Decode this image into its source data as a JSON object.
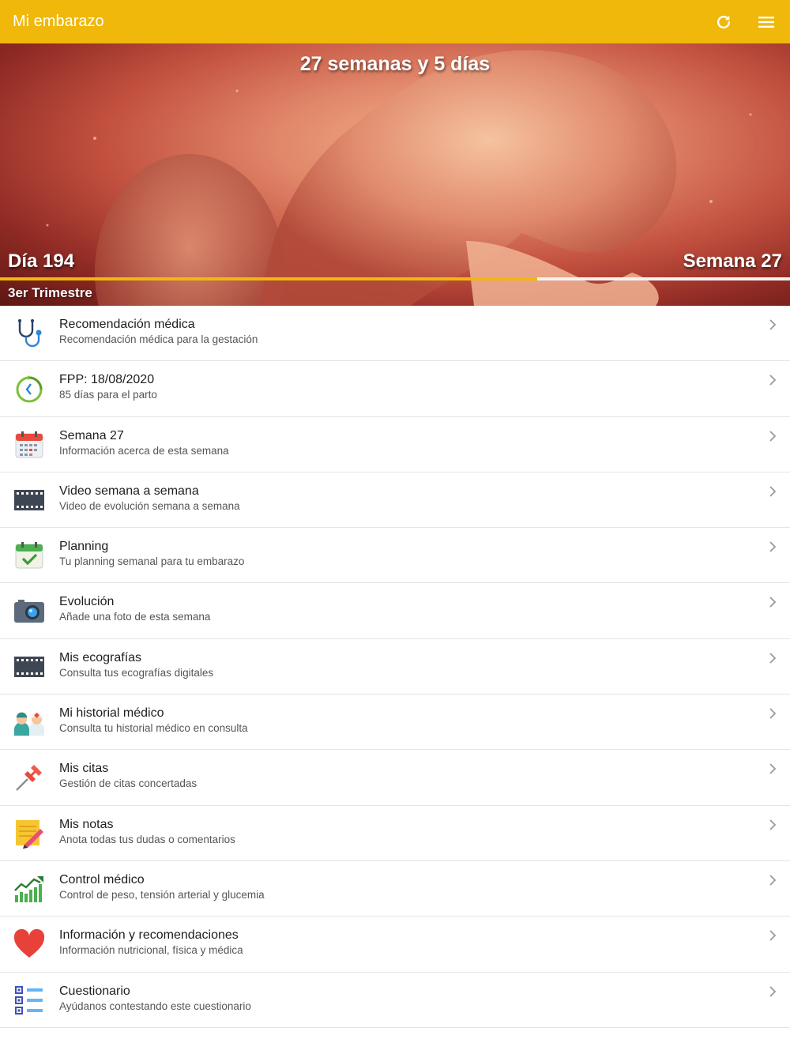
{
  "appbar": {
    "title": "Mi embarazo",
    "refresh_icon": "refresh-icon",
    "menu_icon": "menu-icon",
    "color": "#efb80a"
  },
  "hero": {
    "headline": "27 semanas y 5 días",
    "day_label": "Día 194",
    "week_label": "Semana 27",
    "trimester_label": "3er Trimestre",
    "progress_fraction": 0.68
  },
  "menu": [
    {
      "title": "Recomendación médica",
      "subtitle": "Recomendación médica para la gestación",
      "icon": "stethoscope-icon"
    },
    {
      "title": "FPP: 18/08/2020",
      "subtitle": "85 días para el parto",
      "icon": "countdown-clock-icon"
    },
    {
      "title": "Semana 27",
      "subtitle": "Información acerca de esta semana",
      "icon": "calendar-icon"
    },
    {
      "title": "Video semana a semana",
      "subtitle": "Video de evolución semana a semana",
      "icon": "film-strip-icon"
    },
    {
      "title": "Planning",
      "subtitle": "Tu planning semanal para tu embarazo",
      "icon": "calendar-check-icon"
    },
    {
      "title": "Evolución",
      "subtitle": "Añade una foto de esta semana",
      "icon": "camera-icon"
    },
    {
      "title": "Mis ecografías",
      "subtitle": "Consulta tus ecografías digitales",
      "icon": "film-strip-icon"
    },
    {
      "title": "Mi historial médico",
      "subtitle": "Consulta tu historial médico en consulta",
      "icon": "doctors-icon"
    },
    {
      "title": "Mis citas",
      "subtitle": "Gestión de citas concertadas",
      "icon": "pushpin-icon"
    },
    {
      "title": "Mis notas",
      "subtitle": "Anota todas tus dudas o comentarios",
      "icon": "notepad-pencil-icon"
    },
    {
      "title": "Control médico",
      "subtitle": "Control de peso, tensión arterial y glucemia",
      "icon": "growth-chart-icon"
    },
    {
      "title": "Información y recomendaciones",
      "subtitle": "Información nutricional, física y médica",
      "icon": "heart-icon"
    },
    {
      "title": "Cuestionario",
      "subtitle": "Ayúdanos contestando este cuestionario",
      "icon": "checklist-icon"
    }
  ]
}
